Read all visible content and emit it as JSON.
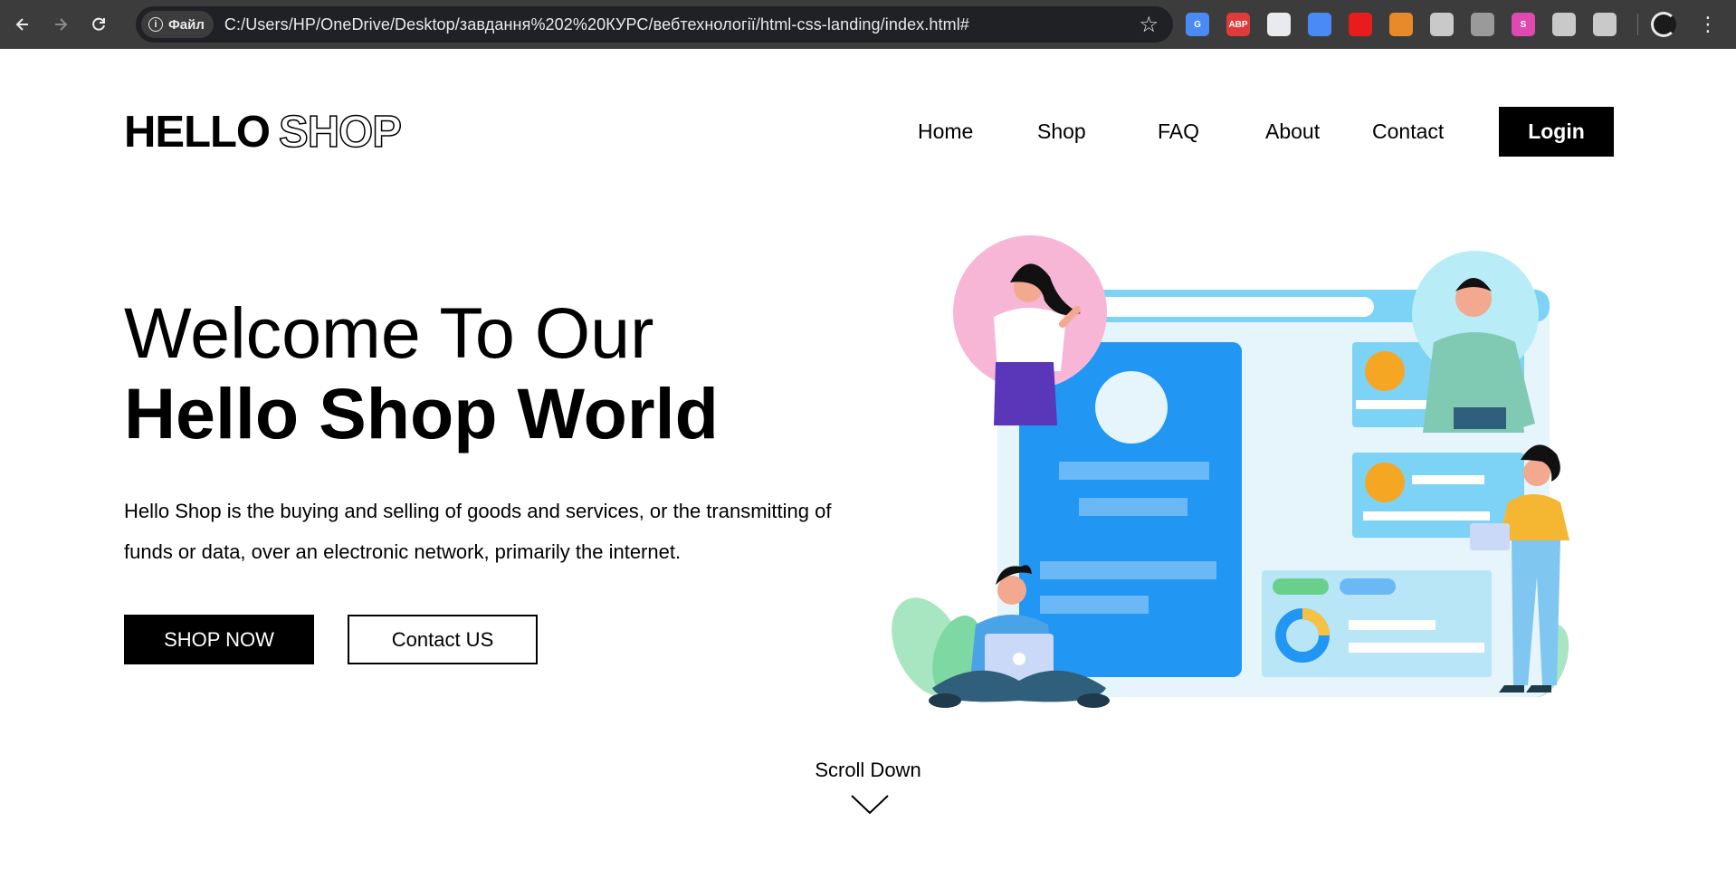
{
  "browser": {
    "back_icon": "arrow-left-icon",
    "forward_icon": "arrow-right-icon",
    "reload_icon": "reload-icon",
    "file_chip_label": "Файл",
    "url": "C:/Users/HP/OneDrive/Desktop/завдання%202%20КУРС/вебтехнології/html-css-landing/index.html#",
    "extensions": [
      {
        "name": "translate-extension-icon",
        "label": "G",
        "color": "#4a8af4"
      },
      {
        "name": "adblock-plus-icon",
        "label": "ABP",
        "color": "#e03a3a"
      },
      {
        "name": "picture-in-picture-icon",
        "label": "",
        "color": "#e8eaed"
      },
      {
        "name": "screen-record-icon",
        "label": "",
        "color": "#4a8af4"
      },
      {
        "name": "red-stop-icon",
        "label": "",
        "color": "#e81c1c"
      },
      {
        "name": "fox-extension-icon",
        "label": "",
        "color": "#e88a2a"
      },
      {
        "name": "octocat-icon",
        "label": "",
        "color": "#c9c9c9"
      },
      {
        "name": "crossed-tool-icon",
        "label": "",
        "color": "#9a9a9a"
      },
      {
        "name": "s-extension-icon",
        "label": "S",
        "color": "#e04ab0"
      },
      {
        "name": "crop-icon",
        "label": "",
        "color": "#c9c9c9"
      },
      {
        "name": "extensions-puzzle-icon",
        "label": "",
        "color": "#c9c9c9"
      }
    ]
  },
  "header": {
    "logo_bold": "HELLO",
    "logo_outline": "SHOP",
    "menu": [
      {
        "label": "Home"
      },
      {
        "label": "Shop"
      },
      {
        "label": "FAQ"
      },
      {
        "label": "About"
      },
      {
        "label": "Contact"
      }
    ],
    "login_label": "Login"
  },
  "hero": {
    "title_line1": "Welcome To Our",
    "title_line2": "Hello Shop World",
    "description": "Hello Shop is the buying and selling of goods and services, or the transmitting of funds or data, over an electronic network, primarily the internet.",
    "primary_button": "SHOP NOW",
    "secondary_button": "Contact US"
  },
  "scroll": {
    "label": "Scroll Down",
    "icon": "chevron-down-icon"
  },
  "colors": {
    "accent_blue": "#2196f3",
    "light_blue": "#7dd3f5",
    "pale_blue": "#e6f4fb",
    "orange": "#f5a623",
    "pink": "#f7b6d6",
    "green": "#69d08b"
  }
}
